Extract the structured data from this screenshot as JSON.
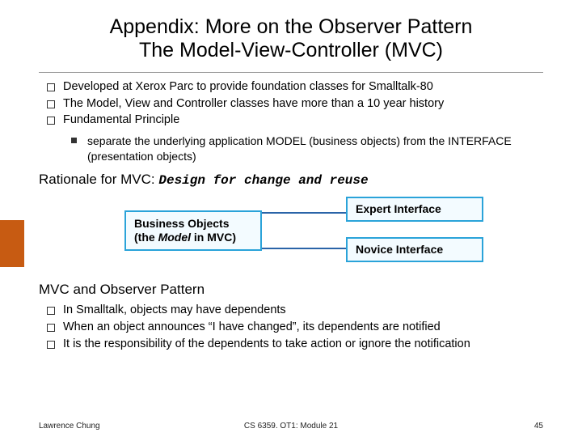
{
  "title": {
    "line1": "Appendix: More on the Observer Pattern",
    "line2": "The Model-View-Controller (MVC)"
  },
  "bullets1": [
    "Developed at Xerox Parc to provide foundation classes for Smalltalk-80",
    "The Model, View and Controller classes have more than a 10 year history",
    "Fundamental Principle"
  ],
  "subbullet1": "separate the underlying application MODEL (business objects) from the INTERFACE (presentation objects)",
  "rationale": {
    "label": "Rationale for MVC:",
    "em": "Design for change and reuse"
  },
  "boxes": {
    "left_l1": "Business Objects",
    "left_l2a": "(the ",
    "left_l2b": "Model",
    "left_l2c": " in MVC)",
    "tr": "Expert Interface",
    "br": "Novice Interface"
  },
  "section2": "MVC and Observer Pattern",
  "bullets2": [
    "In Smalltalk, objects may have dependents",
    "When an object announces “I have changed”, its dependents are notified",
    "It is the responsibility of the dependents to take action or ignore the notification"
  ],
  "footer": {
    "left": "Lawrence Chung",
    "mid": "CS 6359. OT1: Module 21",
    "right": "45"
  }
}
